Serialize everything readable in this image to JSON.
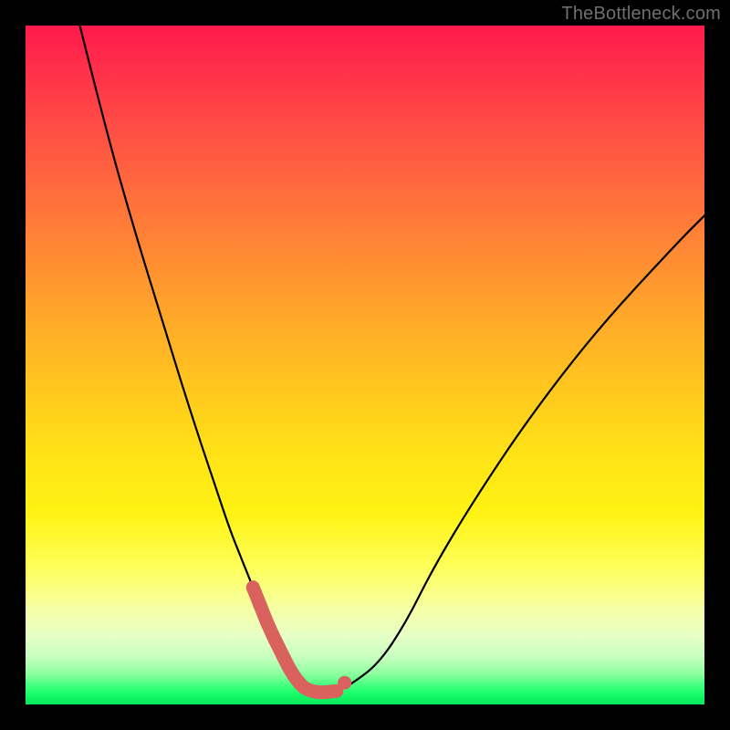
{
  "watermark": "TheBottleneck.com",
  "colors": {
    "frame": "#000000",
    "curve": "#000000",
    "marker": "#d9625f",
    "gradient_stops": [
      "#ff1a4d",
      "#ff2e4a",
      "#ff4a45",
      "#ff6b3e",
      "#ff8b33",
      "#ffab28",
      "#ffc81e",
      "#ffe216",
      "#fff314",
      "#feff5c",
      "#f6ffa6",
      "#e6ffc6",
      "#c7ffc0",
      "#8dff9e",
      "#4bff82",
      "#20ff6e",
      "#10f562",
      "#0be85a"
    ]
  },
  "chart_data": {
    "type": "line",
    "title": "",
    "xlabel": "",
    "ylabel": "",
    "xlim": [
      0,
      100
    ],
    "ylim": [
      0,
      100
    ],
    "grid": false,
    "legend": false,
    "annotations": [
      "TheBottleneck.com"
    ],
    "series": [
      {
        "name": "bottleneck-curve",
        "x": [
          8,
          12,
          16,
          20,
          24,
          28,
          30,
          32,
          34,
          36,
          37,
          38,
          39,
          40,
          41,
          42,
          43,
          44,
          46,
          48,
          52,
          56,
          60,
          66,
          74,
          84,
          96,
          100
        ],
        "y": [
          100,
          84,
          70,
          57,
          44,
          32,
          26,
          21,
          16,
          11,
          9,
          7,
          5,
          3.5,
          2.5,
          2,
          1.8,
          1.8,
          2,
          3,
          6,
          12,
          20,
          30,
          42,
          55,
          68,
          72
        ]
      }
    ],
    "markers": [
      {
        "name": "flat-min-start",
        "x": 39,
        "y": 2.0
      },
      {
        "name": "flat-min-mid",
        "x": 41,
        "y": 1.8
      },
      {
        "name": "flat-min-end",
        "x": 44,
        "y": 1.8
      },
      {
        "name": "right-knee",
        "x": 47,
        "y": 3.2
      }
    ],
    "minimum": {
      "x": 42,
      "y": 1.8
    }
  }
}
